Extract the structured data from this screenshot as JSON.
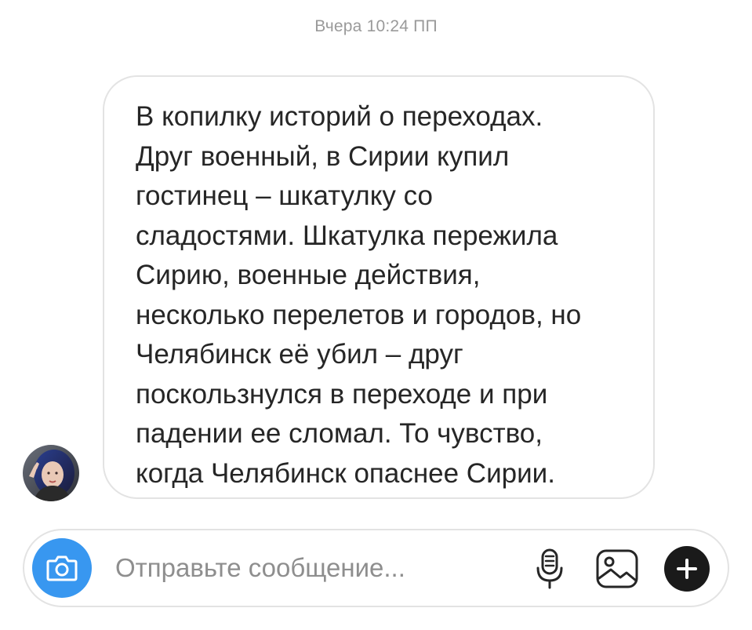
{
  "chat": {
    "timestamp": "Вчера 10:24 ПП",
    "message": {
      "text": "В копилку историй о переходах.\nДруг военный, в Сирии купил\nгостинец – шкатулку со\nсладостями. Шкатулка пережила\nСирию, военные действия,\nнесколько перелетов и городов, но\nЧелябинск её убил – друг\nпоскользнулся в переходе и при\nпадении ее сломал.  То чувство,\nкогда Челябинск опаснее Сирии."
    },
    "sender_avatar": "profile-photo"
  },
  "composer": {
    "placeholder": "Отправьте сообщение...",
    "value": "",
    "camera_icon": "camera-icon",
    "mic_icon": "microphone-icon",
    "gallery_icon": "image-icon",
    "plus_icon": "plus-icon"
  },
  "colors": {
    "accent": "#3897f0",
    "text": "#262626",
    "muted": "#9a9a9a",
    "border": "#e3e3e3"
  }
}
